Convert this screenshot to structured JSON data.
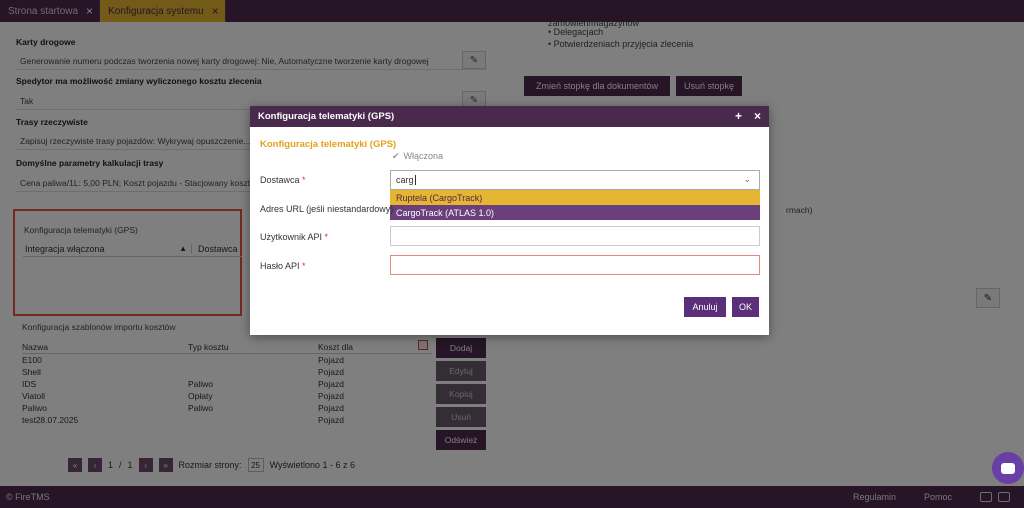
{
  "tabs": [
    {
      "label": "Strona startowa",
      "close": "×"
    },
    {
      "label": "Konfiguracja systemu",
      "close": "×"
    }
  ],
  "left": {
    "sections": [
      {
        "title": "Karty drogowe",
        "value": "Generowanie numeru podczas tworzenia nowej karty drogowej: Nie, Automatyczne tworzenie karty drogowej"
      },
      {
        "title": "Spedytor ma możliwość zmiany wyliczonego kosztu zlecenia",
        "value": "Tak"
      },
      {
        "title": "Trasy rzeczywiste",
        "value": "Zapisuj rzeczywiste trasy pojazdów: Wykrywaj opuszczenie..."
      },
      {
        "title": "Domyślne parametry kalkulacji trasy",
        "value": "Cena paliwa/1L: 5,00 PLN; Koszt pojazdu - Stacjowany koszt..."
      }
    ],
    "gps": {
      "label": "Konfiguracja telematyki (GPS)",
      "col1": "Integracja włączona",
      "sort": "▲",
      "col2": "Dostawca"
    },
    "import": {
      "title": "Konfiguracja szablonów importu kosztów",
      "headers": [
        "Nazwa",
        "Typ kosztu",
        "Koszt dla"
      ],
      "rows": [
        [
          "E100",
          "",
          "Pojazd"
        ],
        [
          "Shell",
          "",
          "Pojazd"
        ],
        [
          "IDS",
          "Paliwo",
          "Pojazd"
        ],
        [
          "Viatoll",
          "Opłaty",
          "Pojazd"
        ],
        [
          "Paliwo",
          "Paliwo",
          "Pojazd"
        ],
        [
          "test28.07.2025",
          "",
          "Pojazd"
        ]
      ],
      "buttons": [
        "Dodaj",
        "Edytuj",
        "Kopiuj",
        "Usuń",
        "Odśwież"
      ]
    },
    "pager": {
      "first": "«",
      "prev": "‹",
      "page": "1",
      "sep": "/",
      "total": "1",
      "next": "›",
      "last": "»",
      "size_label": "Rozmiar strony:",
      "size": "25",
      "shown": "Wyświetlono 1 - 6 z 6"
    }
  },
  "right": {
    "list": [
      "zamówień/magazynów",
      "Delegacjach",
      "Potwierdzeniach przyjęcia zlecenia"
    ],
    "btn_change": "Zmień stopkę dla dokumentów",
    "btn_remove": "Usuń stopkę",
    "fragment": "rmach)"
  },
  "bottom": {
    "brand": "© FireTMS",
    "regulamin": "Regulamin",
    "pomoc": "Pomoc"
  },
  "modal": {
    "title": "Konfiguracja telematyki (GPS)",
    "pin": "+",
    "close": "×",
    "subtitle": "Konfiguracja telematyki (GPS)",
    "check_mark": "✔",
    "check_label": "Włączona",
    "provider_label": "Dostawca",
    "required_mark": "*",
    "provider_value": "carg",
    "chevron": "⌄",
    "options": [
      "Ruptela (CargoTrack)",
      "CargoTrack (ATLAS 1.0)"
    ],
    "url_label": "Adres URL (jeśli niestandardowy)",
    "user_label": "Użytkownik API",
    "pass_label": "Hasło API",
    "cancel": "Anuluj",
    "ok": "OK"
  },
  "colors": {
    "brand": "#4a2a4c",
    "accent": "#e6b532",
    "error": "#e8553c",
    "button": "#5c2f7a"
  }
}
